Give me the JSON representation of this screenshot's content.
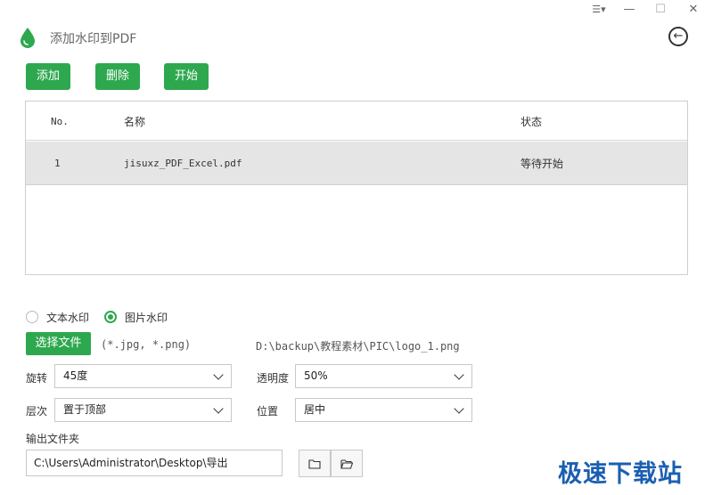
{
  "app": {
    "title": "添加水印到PDF",
    "brand_color": "#2ea84e"
  },
  "titlebar": {
    "menu_glyph": "☰▾",
    "minimize_glyph": "—",
    "maximize_glyph": "☐",
    "close_glyph": "✕"
  },
  "toolbar": {
    "add_label": "添加",
    "delete_label": "删除",
    "start_label": "开始"
  },
  "table": {
    "headers": {
      "no": "No.",
      "name": "名称",
      "status": "状态"
    },
    "rows": [
      {
        "no": "1",
        "name": "jisuxz_PDF_Excel.pdf",
        "status": "等待开始"
      }
    ]
  },
  "watermark_type": {
    "text_label": "文本水印",
    "image_label": "图片水印",
    "selected": "image"
  },
  "image": {
    "choose_label": "选择文件",
    "hint": "(*.jpg, *.png)",
    "path": "D:\\backup\\教程素材\\PIC\\logo_1.png"
  },
  "settings": {
    "rotate_label": "旋转",
    "rotate_value": "45度",
    "opacity_label": "透明度",
    "opacity_value": "50%",
    "layer_label": "层次",
    "layer_value": "置于顶部",
    "position_label": "位置",
    "position_value": "居中"
  },
  "output": {
    "label": "输出文件夹",
    "path": "C:\\Users\\Administrator\\Desktop\\导出"
  },
  "site_watermark": "极速下载站",
  "icons": {
    "logo": "droplet-icon",
    "back": "back-arrow-icon",
    "folder": "folder-icon",
    "open_folder": "folder-open-icon"
  }
}
